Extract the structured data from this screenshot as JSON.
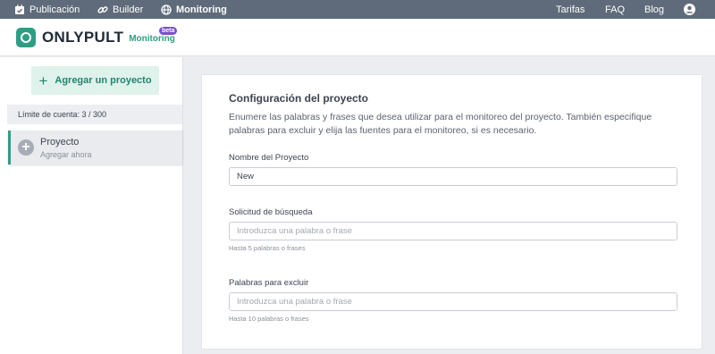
{
  "topnav": {
    "items": [
      {
        "label": "Publicación",
        "icon": "calendar-check-icon"
      },
      {
        "label": "Builder",
        "icon": "link-icon"
      },
      {
        "label": "Monitoring",
        "icon": "globe-icon"
      }
    ],
    "right": {
      "pricing": "Tarifas",
      "faq": "FAQ",
      "blog": "Blog",
      "account_icon": "user-circle-icon"
    }
  },
  "header": {
    "logo_text": "ONLYPULT",
    "logo_sub": "Monitoring",
    "badge": "beta"
  },
  "sidebar": {
    "add_button": "Agregar un proyecto",
    "limit": "Límite de cuenta: 3 / 300",
    "project": {
      "title": "Proyecto",
      "subtitle": "Agregar ahora"
    }
  },
  "main": {
    "title": "Configuración del proyecto",
    "description": "Enumere las palabras y frases que desea utilizar para el monitoreo del proyecto. También especifique palabras para excluir y elija las fuentes para el monitoreo, si es necesario.",
    "fields": [
      {
        "label": "Nombre del Proyecto",
        "value": "New",
        "placeholder": "",
        "help": ""
      },
      {
        "label": "Solicitud de búsqueda",
        "value": "",
        "placeholder": "Introduzca una palabra o frase",
        "help": "Hasta 5 palabras o frases"
      },
      {
        "label": "Palabras para excluir",
        "value": "",
        "placeholder": "Introduzca una palabra o frase",
        "help": "Hasta 10 palabras o frases"
      }
    ]
  },
  "colors": {
    "topnav": "#5f6b7a",
    "accent": "#2f9d84",
    "badge": "#7a4fd1"
  }
}
